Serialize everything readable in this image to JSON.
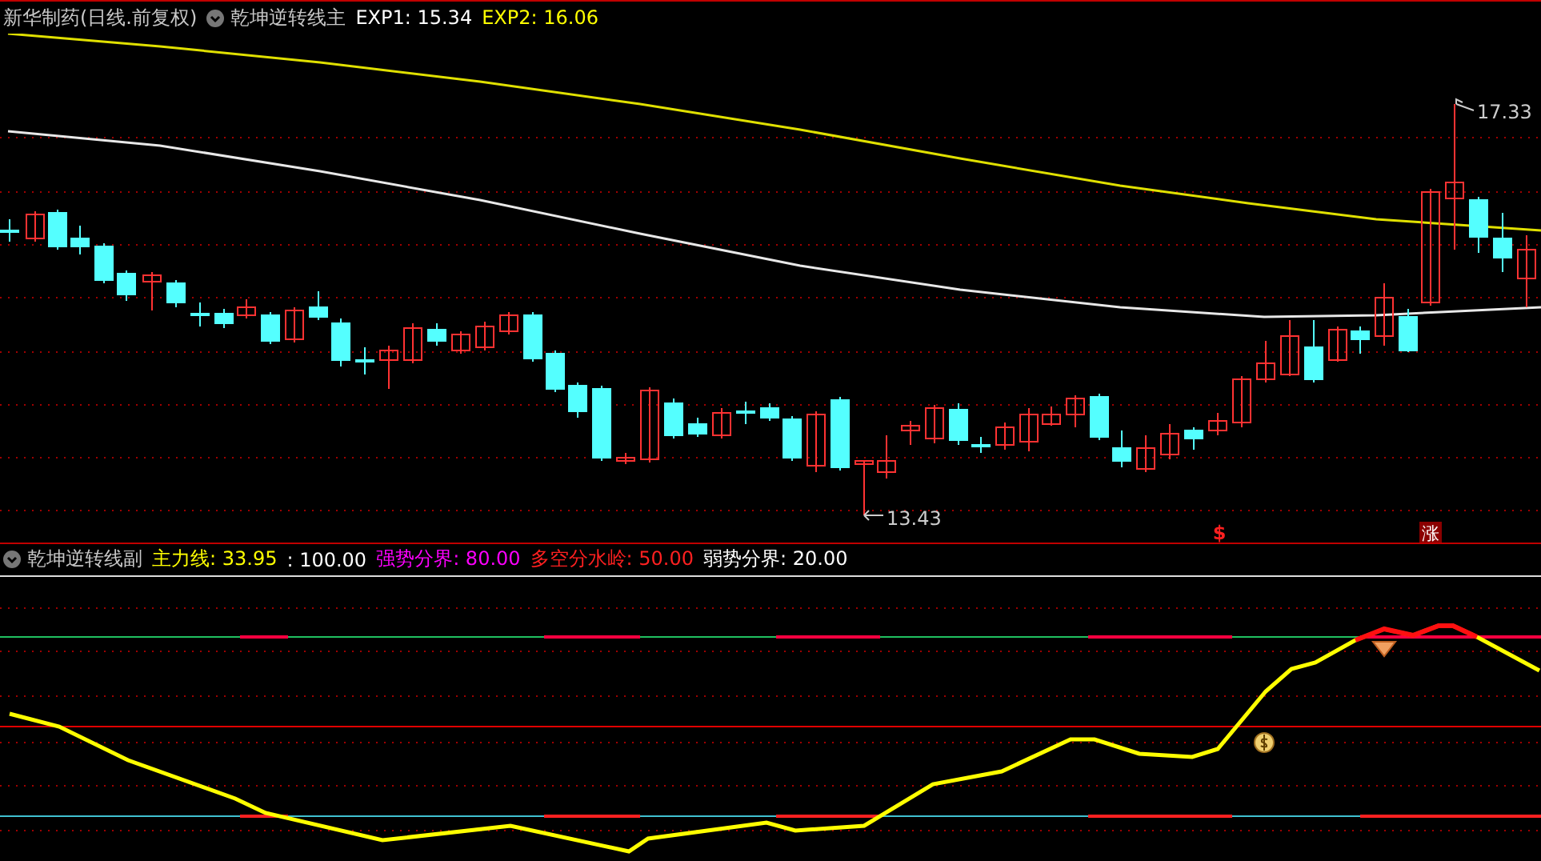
{
  "main_panel": {
    "legend": [
      {
        "text": "新华制药(日线.前复权)",
        "color": "#c8c8c8"
      },
      {
        "text": "乾坤逆转线主",
        "color": "#c8c8c8",
        "kind": "indicator"
      },
      {
        "text": "EXP1: 15.34",
        "color": "#ffffff"
      },
      {
        "text": "EXP2: 16.06",
        "color": "#ffff00"
      }
    ],
    "high_label": "17.33",
    "low_label": "13.43",
    "markers": [
      {
        "text": "$",
        "kind": "signal"
      },
      {
        "text": "涨",
        "kind": "badge"
      }
    ]
  },
  "sub_panel": {
    "legend": [
      {
        "text": "乾坤逆转线副",
        "color": "#c8c8c8",
        "kind": "indicator"
      },
      {
        "text": "主力线: 33.95",
        "color": "#ffff00"
      },
      {
        "text": ": 100.00",
        "color": "#ffffff"
      },
      {
        "text": "强势分界: 80.00",
        "color": "#ff00ff"
      },
      {
        "text": "多空分水岭: 50.00",
        "color": "#ff2020"
      },
      {
        "text": "弱势分界: 20.00",
        "color": "#ffffff"
      }
    ]
  }
}
